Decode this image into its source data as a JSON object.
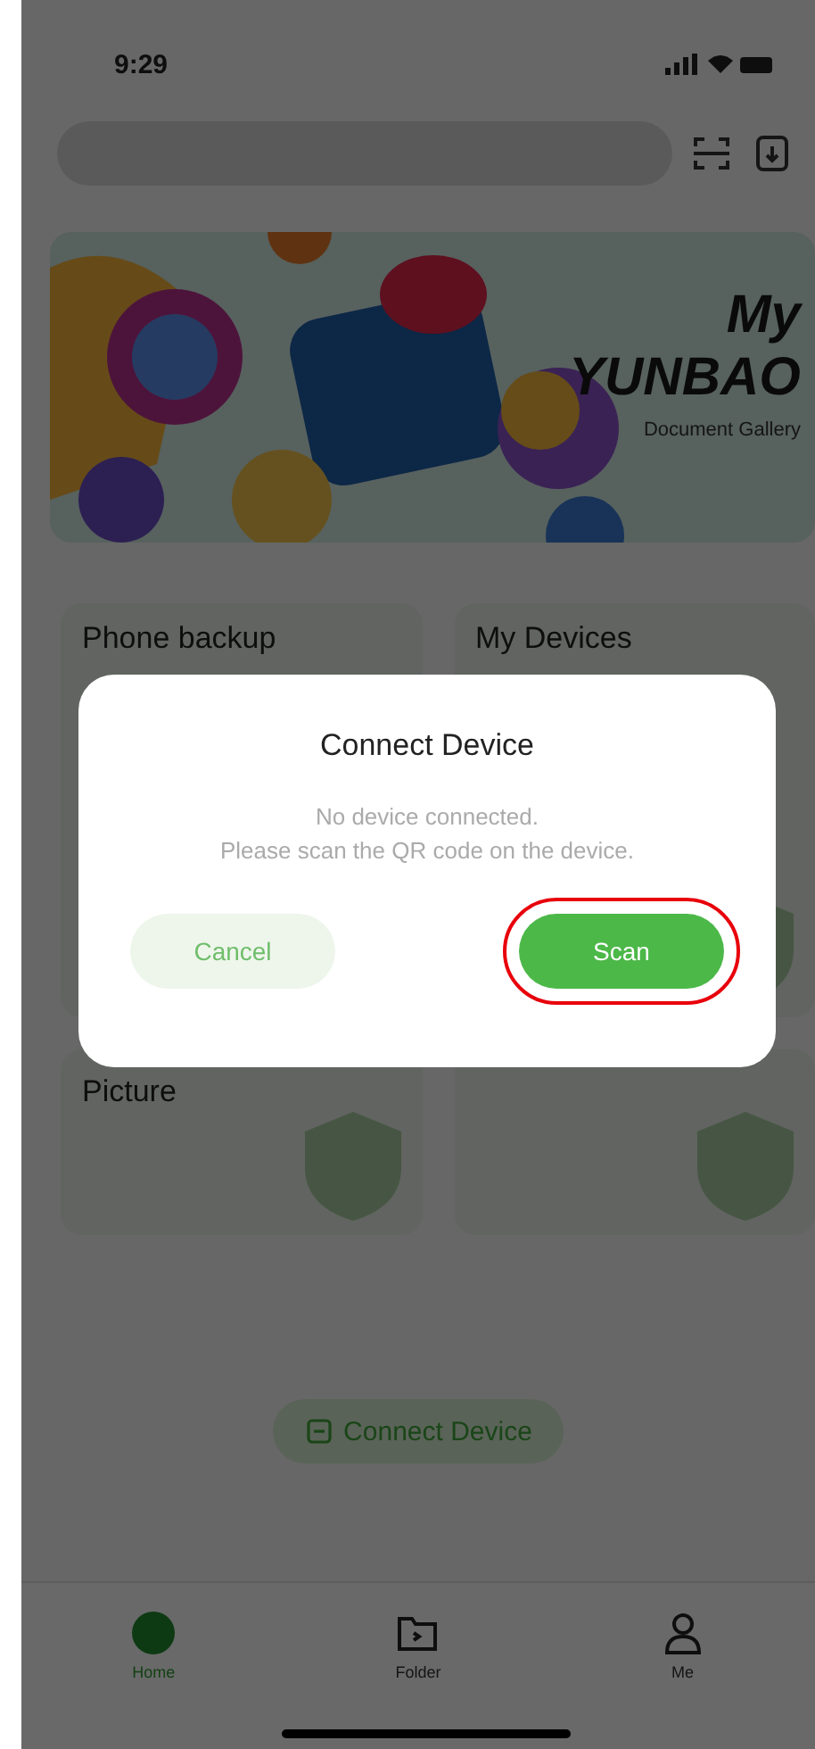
{
  "status_bar": {
    "time": "9:29"
  },
  "banner": {
    "kind": "picture",
    "title": "My",
    "brand": "YUNBAO",
    "subtitle": "Document Gallery"
  },
  "cards": [
    {
      "kind": "titled",
      "title": "Phone backup"
    },
    {
      "kind": "titled",
      "title": "My Devices"
    },
    {
      "kind": "titled",
      "title": "Picture"
    },
    {
      "kind": "plain"
    }
  ],
  "connect_button": {
    "label": "Connect Device"
  },
  "tab_bar": [
    {
      "label": "Home",
      "selected": true
    },
    {
      "label": "Folder",
      "selected": false
    },
    {
      "label": "Me",
      "selected": false
    }
  ],
  "dialog": {
    "title": "Connect Device",
    "message": [
      "No device connected.",
      "Please scan the QR code on the device."
    ],
    "buttons": [
      {
        "label": "Cancel",
        "kind": "secondary",
        "highlighted": false
      },
      {
        "label": "Scan",
        "kind": "primary",
        "highlighted": true
      }
    ]
  }
}
